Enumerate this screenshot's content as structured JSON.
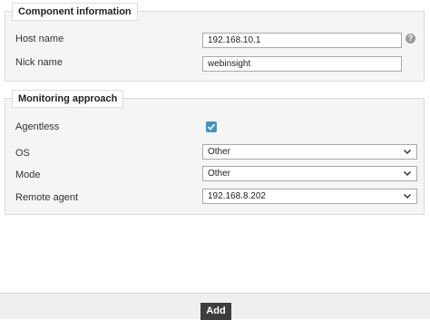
{
  "component_info": {
    "legend": "Component information",
    "host_name": {
      "label": "Host name",
      "value": "192.168.10.1",
      "help_icon": "question-mark-icon"
    },
    "nick_name": {
      "label": "Nick name",
      "value": "webinsight"
    }
  },
  "monitoring": {
    "legend": "Monitoring approach",
    "agentless": {
      "label": "Agentless",
      "checked": true
    },
    "os": {
      "label": "OS",
      "selected": "Other"
    },
    "mode": {
      "label": "Mode",
      "selected": "Other"
    },
    "remote_agent": {
      "label": "Remote agent",
      "selected": "192.168.8.202"
    }
  },
  "footer": {
    "add_label": "Add"
  },
  "colors": {
    "checkbox": "#3f94c8",
    "button": "#3d3d3d",
    "panel": "#f5f5f5"
  }
}
